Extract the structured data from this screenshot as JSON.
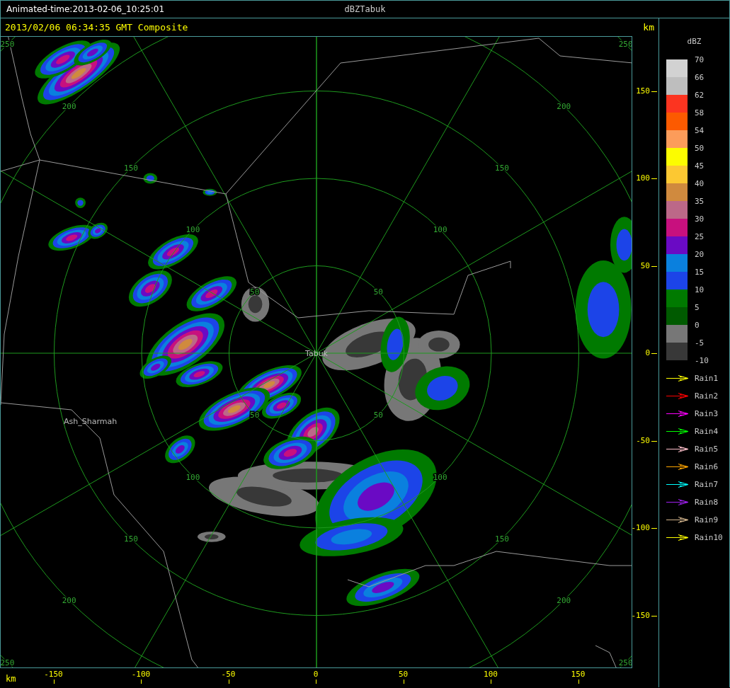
{
  "window": {
    "animation_time": "Animated-time:2013-02-06_10:25:01",
    "title": "dBZTabuk"
  },
  "header": {
    "timestamp": "2013/02/06 06:34:35 GMT Composite",
    "unit": "km"
  },
  "map": {
    "center_label": "Tabuk",
    "place_labels": [
      "Ash_Sharmah"
    ],
    "rings": [
      {
        "labels": [
          "50",
          "50",
          "50",
          "50"
        ]
      },
      {
        "labels": [
          "100",
          "100",
          "100",
          "100"
        ]
      },
      {
        "labels": [
          "150",
          "150",
          "150",
          "150"
        ]
      },
      {
        "labels": [
          "200",
          "200",
          "200",
          "200"
        ]
      },
      {
        "labels": [
          "250",
          "250",
          "250",
          "250"
        ]
      }
    ]
  },
  "y_axis": {
    "ticks": [
      "150",
      "100",
      "50",
      "0",
      "-50",
      "-100",
      "-150"
    ]
  },
  "x_axis": {
    "unit": "km",
    "ticks": [
      "-150",
      "-100",
      "-50",
      "0",
      "50",
      "100",
      "150"
    ]
  },
  "legend": {
    "title": "dBZ",
    "bins": [
      {
        "color": "#d2d2d2"
      },
      {
        "color": "#bebebe"
      },
      {
        "color": "#fc3420"
      },
      {
        "color": "#fc5a00"
      },
      {
        "color": "#fc9c5a"
      },
      {
        "color": "#fcfc00"
      },
      {
        "color": "#fcc832"
      },
      {
        "color": "#d08a3e"
      },
      {
        "color": "#bc6888"
      },
      {
        "color": "#c8107e"
      },
      {
        "color": "#6a0ac4"
      },
      {
        "color": "#0a80de"
      },
      {
        "color": "#1c44e8"
      },
      {
        "color": "#007a00"
      },
      {
        "color": "#005a00"
      },
      {
        "color": "#777777"
      },
      {
        "color": "#383838"
      }
    ],
    "labels": [
      "70",
      "66",
      "62",
      "58",
      "54",
      "50",
      "45",
      "40",
      "35",
      "30",
      "25",
      "20",
      "15",
      "10",
      "5",
      "0",
      "-5",
      "-10"
    ],
    "tracks": [
      {
        "label": "Rain1",
        "color": "#ffff00"
      },
      {
        "label": "Rain2",
        "color": "#ff0000"
      },
      {
        "label": "Rain3",
        "color": "#ff00ff"
      },
      {
        "label": "Rain4",
        "color": "#00ff00"
      },
      {
        "label": "Rain5",
        "color": "#ffc0cb"
      },
      {
        "label": "Rain6",
        "color": "#ffa500"
      },
      {
        "label": "Rain7",
        "color": "#00ffff"
      },
      {
        "label": "Rain8",
        "color": "#a020f0"
      },
      {
        "label": "Rain9",
        "color": "#d2b48c"
      },
      {
        "label": "Rain10",
        "color": "#ffff00"
      }
    ]
  }
}
